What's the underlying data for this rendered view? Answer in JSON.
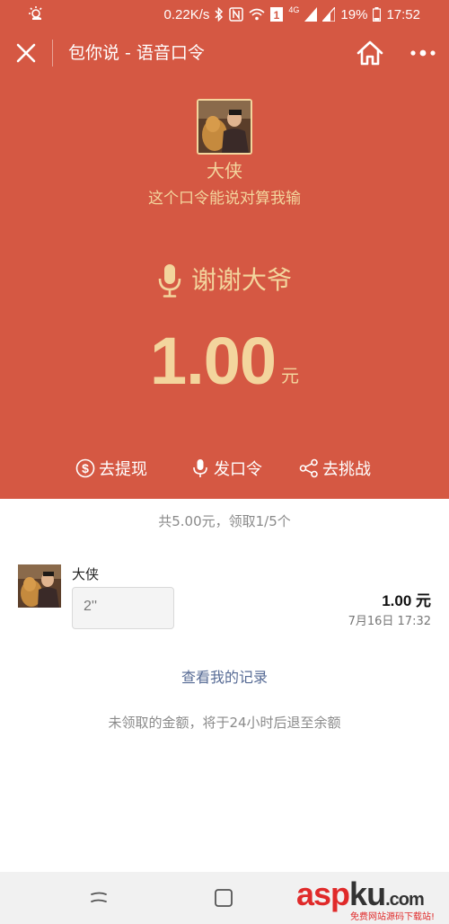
{
  "status_bar": {
    "network_speed": "0.22K/s",
    "network_type": "4G",
    "sim_badge": "1",
    "battery": "19%",
    "time": "17:52"
  },
  "title_bar": {
    "title": "包你说 - 语音口令",
    "close_icon": "close-icon",
    "home_icon": "home-icon",
    "more_icon": "more-icon"
  },
  "sender": {
    "name": "大侠",
    "message": "这个口令能说对算我输"
  },
  "voice_phrase": "谢谢大爷",
  "amount": {
    "value": "1.00",
    "unit": "元"
  },
  "actions": {
    "withdraw": "去提现",
    "send": "发口令",
    "challenge": "去挑战"
  },
  "summary": "共5.00元，领取1/5个",
  "records": [
    {
      "name": "大侠",
      "voice_duration": "2''",
      "amount": "1.00 元",
      "time": "7月16日 17:32"
    }
  ],
  "view_records_link": "查看我的记录",
  "refund_note": "未领取的金额，将于24小时后退至余额",
  "watermark": {
    "brand_asp": "asp",
    "brand_ku": "ku",
    "brand_com": ".com",
    "tagline": "免费网站源码下载站!"
  },
  "colors": {
    "hero_red": "#d55843",
    "gold": "#f3d59d",
    "link_blue": "#576b95"
  }
}
